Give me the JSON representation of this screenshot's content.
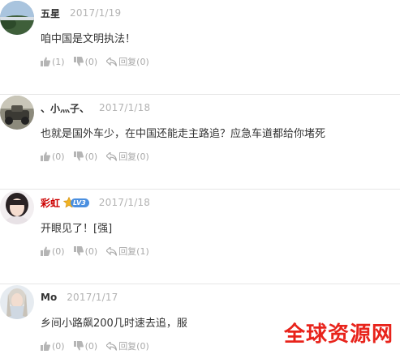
{
  "comments": [
    {
      "username": "五星",
      "date": "2017/1/19",
      "text": "咱中国是文明执法！",
      "likes": "(1)",
      "dislikes": "(0)",
      "reply": "回复(0)"
    },
    {
      "username": "、小灬子、",
      "date": "2017/1/18",
      "text": "也就是国外车少，在中国还能走主路追？应急车道都给你堵死",
      "likes": "(0)",
      "dislikes": "(0)",
      "reply": "回复(0)"
    },
    {
      "username": "彩虹",
      "badge": "LV3",
      "date": "2017/1/18",
      "text": "开眼见了！[强]",
      "likes": "(0)",
      "dislikes": "(0)",
      "reply": "回复(1)"
    },
    {
      "username": "Mo",
      "date": "2017/1/17",
      "text": "乡间小路飙200几时速去追，服",
      "likes": "(0)",
      "dislikes": "(0)",
      "reply": "回复(0)"
    }
  ],
  "watermark": "全球资源网",
  "colors": {
    "name": "#333333",
    "vip_name": "#cc0000",
    "date": "#b3b3b3",
    "watermark": "#e8231b"
  },
  "icons": [
    "thumb-up-icon",
    "thumb-down-icon",
    "reply-arrow-icon",
    "level-star-icon"
  ]
}
